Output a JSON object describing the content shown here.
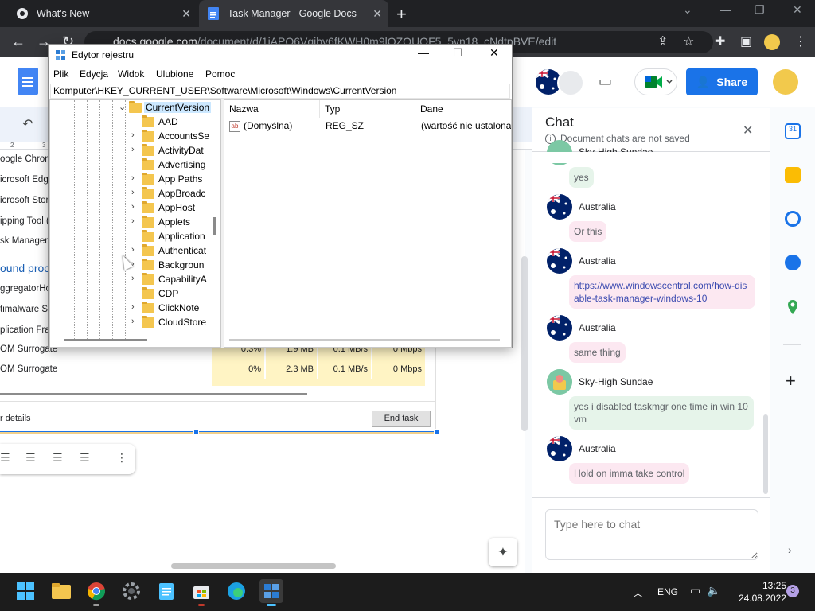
{
  "browser": {
    "tabs": [
      {
        "label": "What's New",
        "icon": "chrome-icon"
      },
      {
        "label": "Task Manager - Google Docs",
        "icon": "docs-icon"
      }
    ],
    "url_prefix": "docs.google.com",
    "url_path": "/document/d/1iAPO6Vgjby6fKWH0m9lOZQUOF5_5vn18_cNdtpBVE/edit"
  },
  "docs": {
    "share_label": "Share",
    "doc_content": {
      "processes": [
        "oogle Chrom",
        "icrosoft Edge",
        "icrosoft Store",
        "ipping Tool (",
        "sk Manager"
      ],
      "section_heading": "ound proc",
      "bg_processes": [
        "ggregatorHos",
        "timalware Se",
        "plication Fra"
      ],
      "rows": [
        {
          "name": "OM Surrogate",
          "cpu": "0.3%",
          "mem": "1.9 MB",
          "disk": "0.1 MB/s",
          "net": "0 Mbps"
        },
        {
          "name": "OM Surrogate",
          "cpu": "0%",
          "mem": "2.3 MB",
          "disk": "0.1 MB/s",
          "net": "0 Mbps"
        }
      ],
      "fewer_details": "r details",
      "end_task": "End task"
    },
    "ruler_marks": [
      "2",
      "3"
    ]
  },
  "chat": {
    "title": "Chat",
    "notice": "Document chats are not saved",
    "messages": [
      {
        "sender": "Sky-High Sundae",
        "text": "yes"
      },
      {
        "sender": "Australia",
        "text": "Or this"
      },
      {
        "sender": "Australia",
        "text": "https://www.windowscentral.com/how-disable-task-manager-windows-10"
      },
      {
        "sender": "Australia",
        "text": "same thing"
      },
      {
        "sender": "Sky-High Sundae",
        "text": "yes i disabled taskmgr one time in win 10 vm"
      },
      {
        "sender": "Australia",
        "text": "Hold on imma take control"
      }
    ],
    "input_placeholder": "Type here to chat"
  },
  "regedit": {
    "title": "Edytor rejestru",
    "menu": [
      "Plik",
      "Edycja",
      "Widok",
      "Ulubione",
      "Pomoc"
    ],
    "address": "Komputer\\HKEY_CURRENT_USER\\Software\\Microsoft\\Windows\\CurrentVersion",
    "tree": [
      {
        "label": "CurrentVersion",
        "selected": true
      },
      {
        "label": "AAD"
      },
      {
        "label": "AccountsSe"
      },
      {
        "label": "ActivityDat"
      },
      {
        "label": "Advertising"
      },
      {
        "label": "App Paths"
      },
      {
        "label": "AppBroadc"
      },
      {
        "label": "AppHost"
      },
      {
        "label": "Applets"
      },
      {
        "label": "Application"
      },
      {
        "label": "Authenticat"
      },
      {
        "label": "Backgroun"
      },
      {
        "label": "CapabilityA"
      },
      {
        "label": "CDP"
      },
      {
        "label": "ClickNote"
      },
      {
        "label": "CloudStore"
      }
    ],
    "columns": [
      "Nazwa",
      "Typ",
      "Dane"
    ],
    "values": [
      {
        "name": "(Domyślna)",
        "type": "REG_SZ",
        "data": "(wartość nie ustalona)"
      }
    ]
  },
  "taskbar": {
    "apps": [
      "start-icon",
      "file-explorer-icon",
      "chrome-icon",
      "settings-icon",
      "notepad-icon",
      "store-icon",
      "edge-icon",
      "regedit-icon"
    ],
    "language": "ENG",
    "time": "13:25",
    "date": "24.08.2022",
    "notifications": "3"
  },
  "colors": {
    "accent_blue": "#1a73e8",
    "chat_pink": "#fce8f1",
    "chat_green": "#e6f4ea",
    "folder_yellow": "#f4c64f",
    "taskbar_bg": "#1c1c1c"
  }
}
